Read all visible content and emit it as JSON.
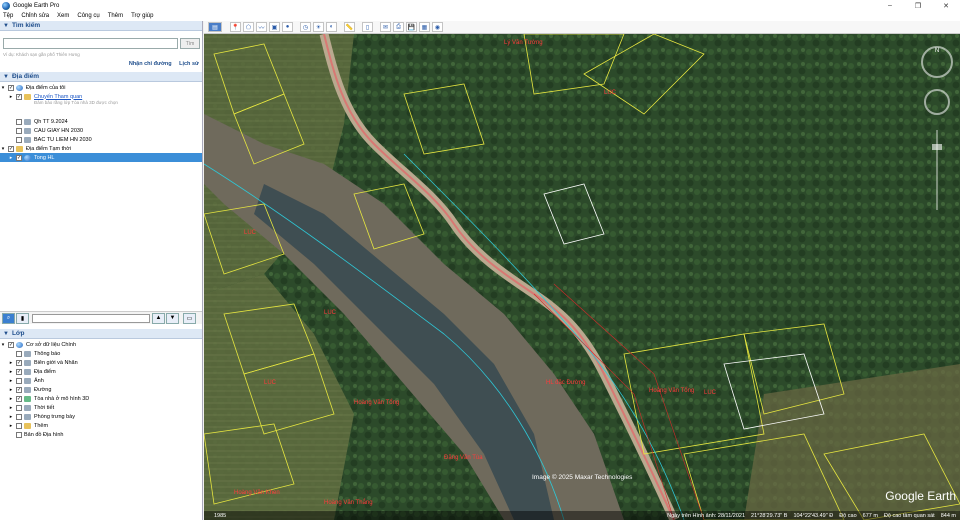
{
  "window": {
    "title": "Google Earth Pro",
    "minimize": "–",
    "maximize": "❐",
    "close": "✕"
  },
  "menu": [
    "Tệp",
    "Chỉnh sửa",
    "Xem",
    "Công cụ",
    "Thêm",
    "Trợ giúp"
  ],
  "search": {
    "header": "Tìm kiếm",
    "button": "Tìm",
    "hint": "Ví dụ: Khách sạn gần phố Thiên Hưng",
    "links": [
      "Nhận chỉ đường",
      "Lịch sử"
    ]
  },
  "places": {
    "header": "Địa điểm",
    "items": [
      {
        "label": "Địa điểm của tôi",
        "checked": true,
        "expanded": true
      },
      {
        "label": "Chuyến Tham quan",
        "checked": true,
        "link": true,
        "note": "Đảm bảo rằng lớp Tòa nhà 3D được chọn"
      },
      {
        "label": "Qh TT 9.2024",
        "checked": false
      },
      {
        "label": "CAU GIAY HN 2030",
        "checked": false
      },
      {
        "label": "BAC TU LIEM HN 2030",
        "checked": false
      },
      {
        "label": "Địa điểm Tạm thời",
        "checked": true,
        "expanded": true
      },
      {
        "label": "Tong HL",
        "checked": true,
        "selected": true
      }
    ]
  },
  "layers": {
    "header": "Lớp",
    "items": [
      {
        "label": "Cơ sở dữ liệu Chính",
        "checked": true
      },
      {
        "label": "Thông báo",
        "checked": false
      },
      {
        "label": "Biên giới và Nhãn",
        "checked": true
      },
      {
        "label": "Địa điểm",
        "checked": true
      },
      {
        "label": "Ảnh",
        "checked": false
      },
      {
        "label": "Đường",
        "checked": true
      },
      {
        "label": "Tòa nhà ở mô hình 3D",
        "checked": true
      },
      {
        "label": "Thời tiết",
        "checked": false
      },
      {
        "label": "Phòng trưng bày",
        "checked": false
      },
      {
        "label": "Thêm",
        "checked": false
      },
      {
        "label": "Bản đồ Địa hình",
        "checked": false
      }
    ]
  },
  "map": {
    "labels": [
      "LUC",
      "LUC",
      "LUC",
      "LUC",
      "LUC",
      "Hoàng Văn Tổng",
      "Hoàng Văn Tổng",
      "Đặng Văn Tùa",
      "Hoàng Văn Khen",
      "Hoàng Văn Thắng",
      "Lý Văn Tường",
      "HL đặc Đường"
    ],
    "credit": "Image © 2025 Maxar Technologies",
    "logo": "Google Earth",
    "status_left": "1985",
    "status": [
      "Ngày trên Hình ảnh: 28/11/2021",
      "21°28'29.73\" B",
      "104°22'43.49\" Đ",
      "Độ cao",
      "677 m",
      "Độ cao tầm quan sát",
      "844 m"
    ]
  }
}
